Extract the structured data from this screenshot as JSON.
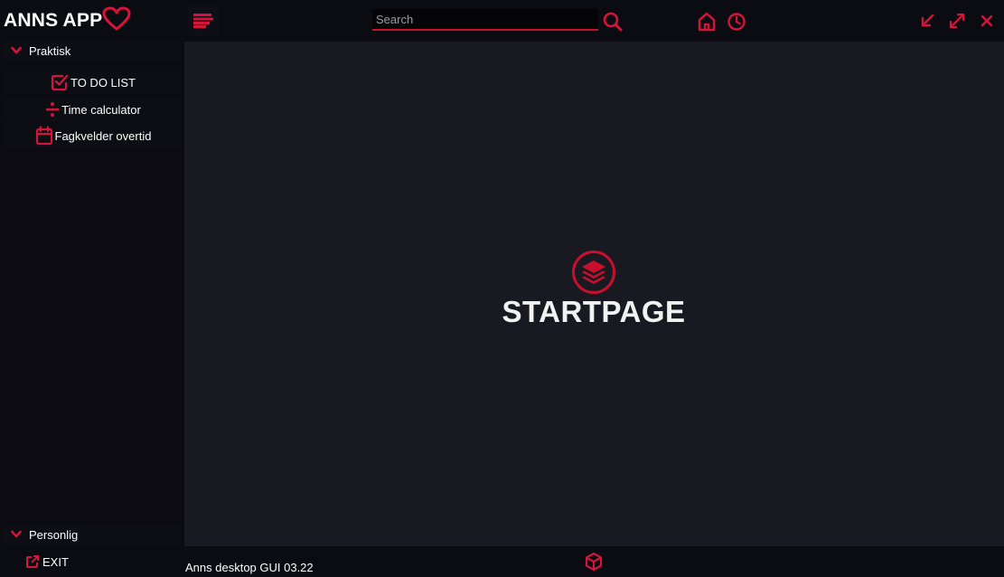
{
  "app": {
    "title": "ANNS APP"
  },
  "search": {
    "placeholder": "Search"
  },
  "sidebar": {
    "section_top": "Praktisk",
    "items": [
      {
        "label": "TO DO LIST",
        "icon": "checkbox-icon"
      },
      {
        "label": "Time calculator",
        "icon": "divide-icon"
      },
      {
        "label": "Fagkvelder overtid",
        "icon": "calendar-icon"
      }
    ],
    "section_bottom": "Personlig",
    "exit_label": "EXIT"
  },
  "main": {
    "title": "STARTPAGE",
    "icon": "layers-icon"
  },
  "status": {
    "text": "Anns desktop GUI 03.22"
  },
  "colors": {
    "accent": "#c8102e",
    "background": "#191922",
    "sidebar": "#0b0b11"
  }
}
